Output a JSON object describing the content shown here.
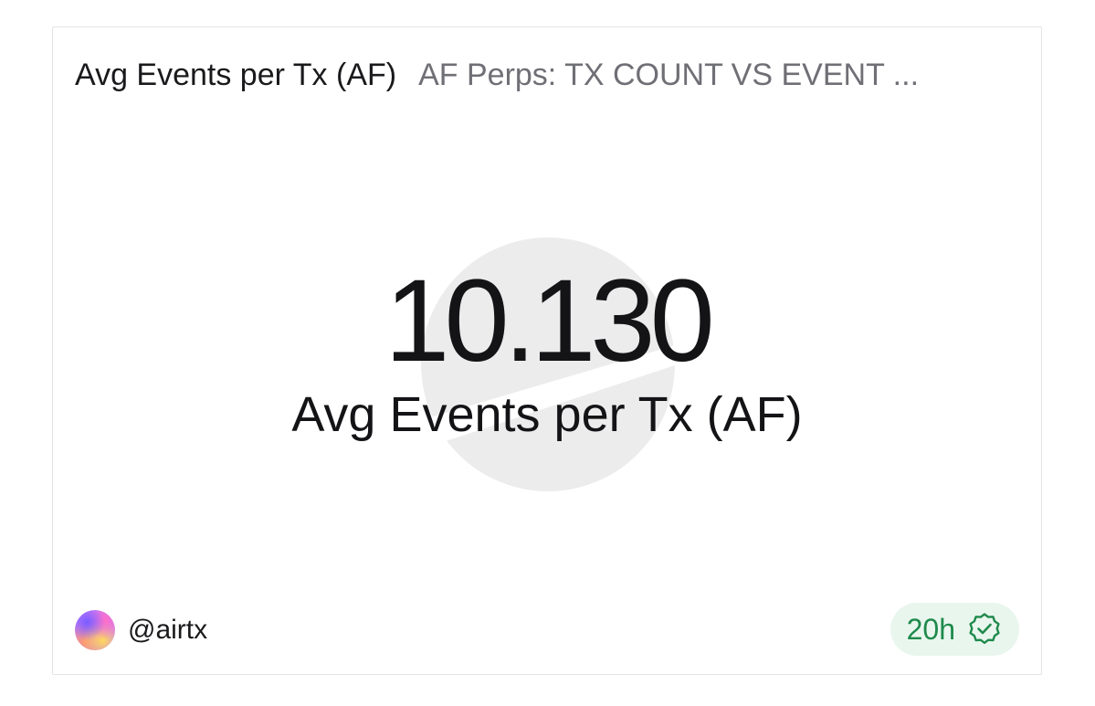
{
  "header": {
    "title": "Avg Events per Tx (AF)",
    "subtitle": "AF Perps: TX COUNT VS EVENT ..."
  },
  "counter": {
    "value": "10.130",
    "label": "Avg Events per Tx (AF)"
  },
  "footer": {
    "author": "@airtx",
    "refresh_age": "20h",
    "badge_icon": "verified-check-icon"
  },
  "colors": {
    "badge_bg": "#e9f6ee",
    "badge_fg": "#1f8a4c",
    "watermark": "#ececed"
  }
}
